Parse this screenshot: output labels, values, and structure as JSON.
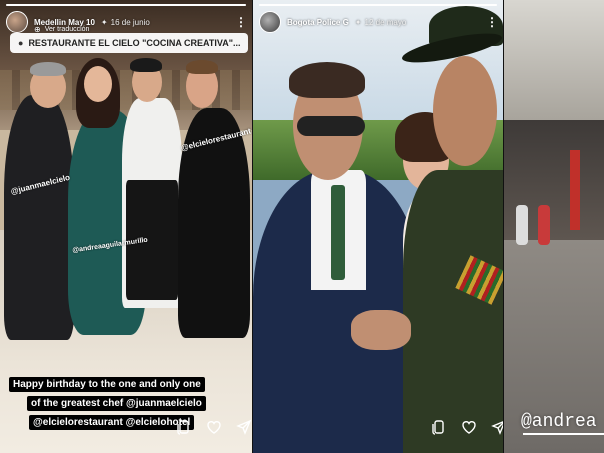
{
  "stories": [
    {
      "username": "Medellin May 10",
      "date": "16 de junio",
      "translate_label": "Ver traducción",
      "location": "RESTAURANTE EL CIELO \"COCINA CREATIVA\"...",
      "mentions": [
        "@juanmaelcielo",
        "@elcielorestaurant",
        "@andreaaguilarmurillo"
      ],
      "caption_lines": [
        "Happy birthday to the one and only one",
        "of the greatest chef @juanmaelcielo",
        "@elcielorestaurant @elcielohotel"
      ],
      "progress": 1.0
    },
    {
      "username": "Bogota Police G",
      "date": "12 de mayo",
      "progress": 1.0
    },
    {
      "mention": "@andrea"
    }
  ],
  "icons": {
    "action_buttons": [
      "copy-icon",
      "heart-icon",
      "send-icon"
    ],
    "menu": "more-options-icon",
    "location": "location-pin-icon",
    "translate": "globe-icon"
  }
}
